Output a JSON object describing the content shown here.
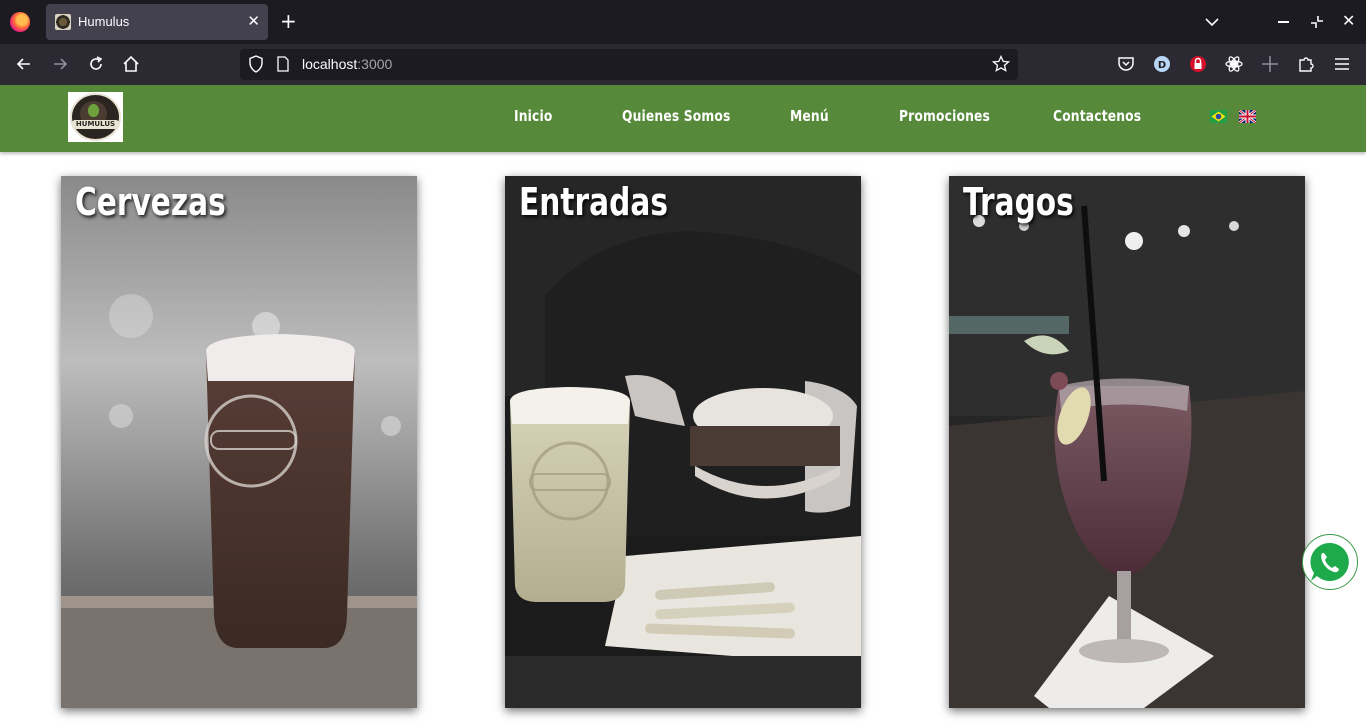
{
  "browser": {
    "tab_title": "Humulus",
    "url_host": "localhost",
    "url_port": ":3000",
    "new_tab_symbol": "+",
    "close_symbol": "✕"
  },
  "site": {
    "nav": [
      {
        "label": "Inicio"
      },
      {
        "label": "Quienes Somos"
      },
      {
        "label": "Menú"
      },
      {
        "label": "Promociones"
      },
      {
        "label": "Contactenos"
      }
    ],
    "logo_text": "HUMULUS",
    "languages": [
      "brazil-flag-icon",
      "uk-flag-icon"
    ]
  },
  "cards": [
    {
      "title": "Cervezas"
    },
    {
      "title": "Entradas"
    },
    {
      "title": "Tragos"
    }
  ],
  "colors": {
    "header_green": "#568a3a",
    "whatsapp_green": "#3c9b48"
  },
  "icons": [
    "firefox-icon",
    "back-icon",
    "forward-icon",
    "reload-icon",
    "home-icon",
    "shield-icon",
    "page-icon",
    "bookmark-star-icon",
    "pocket-icon",
    "account-icon",
    "lock-extension-icon",
    "extension-gear-icon",
    "extension-plus-icon",
    "extensions-icon",
    "menu-icon",
    "whatsapp-icon"
  ]
}
